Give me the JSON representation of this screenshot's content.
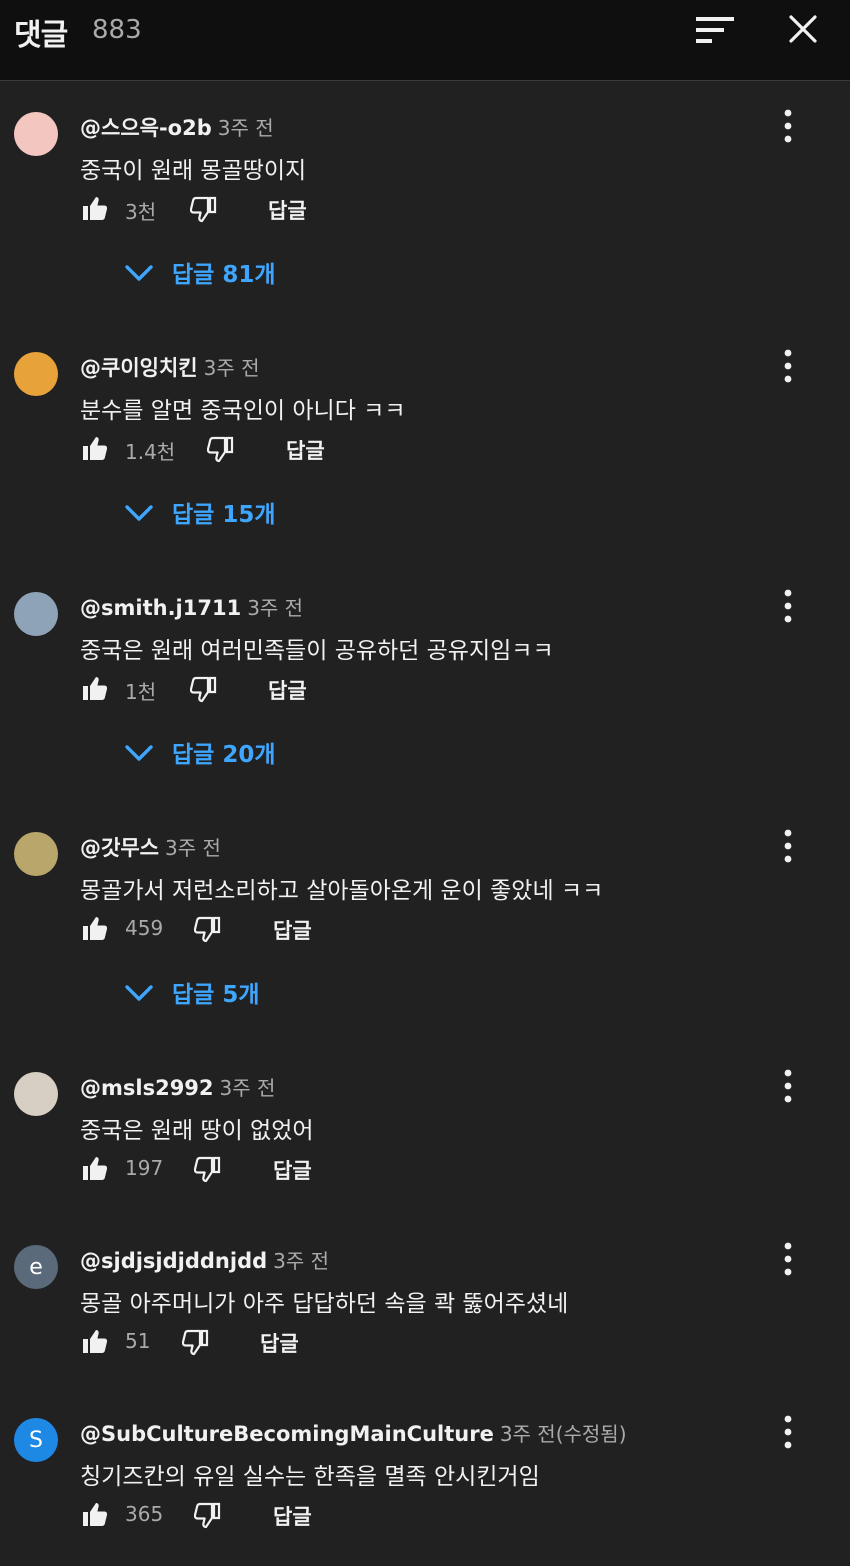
{
  "header": {
    "title": "댓글",
    "count": "883"
  },
  "comments": [
    {
      "author": "@스으윽-o2b",
      "time": "3주 전",
      "text": "중국이 원래 몽골땅이지",
      "likes": "3천",
      "reply_label": "답글",
      "replies_label": "답글 81개",
      "avatar_color": "#f3c7c0"
    },
    {
      "author": "@쿠이잉치킨",
      "time": "3주 전",
      "text": "분수를 알면 중국인이 아니다 ㅋㅋ",
      "likes": "1.4천",
      "reply_label": "답글",
      "replies_label": "답글 15개",
      "avatar_color": "#e8a23a"
    },
    {
      "author": "@smith.j1711",
      "time": "3주 전",
      "text": "중국은 원래 여러민족들이 공유하던 공유지임ㅋㅋ",
      "likes": "1천",
      "reply_label": "답글",
      "replies_label": "답글 20개",
      "avatar_color": "#8fa3b8"
    },
    {
      "author": "@갓무스",
      "time": "3주 전",
      "text": "몽골가서 저런소리하고 살아돌아온게 운이 좋았네 ㅋㅋ",
      "likes": "459",
      "reply_label": "답글",
      "replies_label": "답글 5개",
      "avatar_color": "#b9a66a"
    },
    {
      "author": "@msls2992",
      "time": "3주 전",
      "text": "중국은 원래 땅이 없었어",
      "likes": "197",
      "reply_label": "답글",
      "avatar_color": "#d8cfc4"
    },
    {
      "author": "@sjdjsjdjddnjdd",
      "time": "3주 전",
      "text": "몽골 아주머니가 아주 답답하던 속을 콱 뚫어주셨네",
      "likes": "51",
      "reply_label": "답글",
      "avatar_letter": "e",
      "avatar_color": "#5a6a7a"
    },
    {
      "author": "@SubCultureBecomingMainCulture",
      "time": "3주 전(수정됨)",
      "text": "칭기즈칸의 유일 실수는 한족을 멸족 안시킨거임",
      "likes": "365",
      "reply_label": "답글",
      "avatar_letter": "S",
      "avatar_color": "#1e88e5"
    }
  ],
  "colors": {
    "background": "#212121",
    "header_bg": "#0f0f0f",
    "accent": "#3ea6ff",
    "muted": "#aaaaaa"
  },
  "icons": {
    "sort": "sort-icon",
    "close": "close-icon",
    "like": "thumbs-up-icon",
    "dislike": "thumbs-down-icon",
    "more": "more-vert-icon",
    "expand": "chevron-down-icon"
  }
}
